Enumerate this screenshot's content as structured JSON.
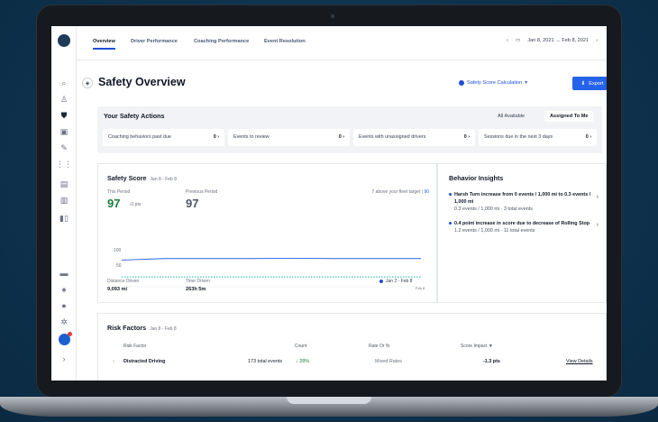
{
  "nav": {
    "tabs": [
      "Overview",
      "Driver Performance",
      "Coaching Performance",
      "Event Resolution"
    ],
    "date_range": "Jan 8, 2021 → Feb 8, 2021"
  },
  "header": {
    "title": "Safety Overview",
    "calc_label": "Safety Score Calculation",
    "export_label": "Export",
    "more": "···"
  },
  "actions": {
    "title": "Your Safety Actions",
    "filter_all": "All Available",
    "filter_me": "Assigned To Me",
    "cards": [
      {
        "label": "Coaching behaviors past due",
        "count": "0"
      },
      {
        "label": "Events to review",
        "count": "0"
      },
      {
        "label": "Events with unassigned drivers",
        "count": "0"
      },
      {
        "label": "Sessions due in the next 3 days",
        "count": "0"
      }
    ]
  },
  "score": {
    "title": "Safety Score",
    "range": "Jan 8 - Feb 8",
    "this_period_label": "This Period",
    "this_period_value": "97",
    "delta": "↓0 pts",
    "prev_label": "Previous Period",
    "prev_value": "97",
    "fleet_text": "7 above your fleet target",
    "fleet_target": "90",
    "axis_100": "100",
    "axis_50": "50",
    "axis_end": "Feb 8",
    "distance_label": "Distance Driven",
    "distance_value": "9,093 mi",
    "time_label": "Time Driven",
    "time_value": "263h 5m",
    "legend_label": "Jan 2 - Feb 8"
  },
  "chart_data": {
    "type": "line",
    "series": [
      {
        "values": [
          92,
          97,
          97,
          97,
          98,
          97,
          97,
          97
        ]
      }
    ],
    "target": 90,
    "x_end_label": "Feb 8",
    "yticks": [
      50,
      100
    ]
  },
  "insights": {
    "title": "Behavior Insights",
    "items": [
      {
        "text": "Harsh Turn increase from 0 events / 1,000 mi to 0.3 events / 1,000 mi",
        "sub": "0.3 events / 1,000 mi  ·  3 total events"
      },
      {
        "text": "0.4 point increase in score due to decrease of Rolling Stop",
        "sub": "1.2 events / 1,000 mi  ·  11 total events"
      }
    ]
  },
  "risk": {
    "title": "Risk Factors",
    "range": "Jan 8 - Feb 8",
    "headers": {
      "factor": "Risk Factor",
      "count": "Count",
      "rate": "Rate Or %",
      "impact": "Score Impact ▼"
    },
    "row": {
      "factor": "Distracted Driving",
      "count": "173 total events",
      "count_delta": "↓ 28%",
      "rate": "Mixed Rates",
      "impact": "-1.3 pts",
      "action": "View Details"
    }
  },
  "colors": {
    "accent": "#2563eb",
    "target": "#14b8a6",
    "positive": "#15803d"
  },
  "icons": [
    "logo",
    "search-icon",
    "drivers-icon",
    "shield-icon",
    "camera-icon",
    "wrench-icon",
    "route-icon",
    "doc-icon",
    "book-icon",
    "chart-icon",
    "chat-icon",
    "bell-icon",
    "help-icon",
    "gear-icon",
    "avatar",
    "chevron-right-icon"
  ]
}
